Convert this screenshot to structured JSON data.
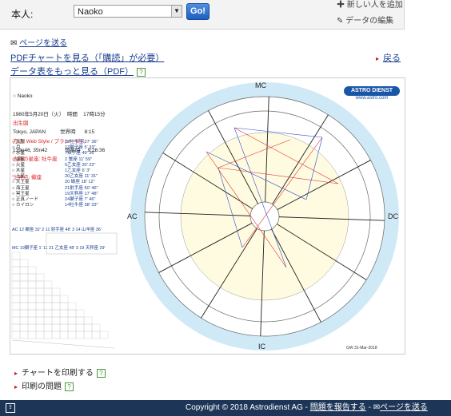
{
  "header": {
    "person_label": "本人:",
    "person_value": "Naoko",
    "go_label": "Go!",
    "add_label": "新しい人を追加",
    "edit_label": "データの編集"
  },
  "links": {
    "send_page": "ページを送る",
    "pdf_chart": "PDFチャートを見る（「購読」が必要）",
    "more_data": "データ表をもっと見る（PDF）",
    "back": "戻る",
    "help_glyph": "?"
  },
  "chart": {
    "name_line": "Naoko",
    "birth_line": "1980年5月20日（火）  時間    17時15分",
    "place_line": "Tokyo, JAPAN          世界時      8:15",
    "coord_line": "139e46, 35n42            恒星時     9:26:36",
    "method1": "出生図",
    "method2": "方法: Web Style / プラシーダス",
    "method3": "太陽の星座: 牡牛座",
    "method4": "上昇点: 蠍座",
    "logo_line1": "ASTRO DIENST",
    "logo_line2": "www.astro.com",
    "mc_label": "MC",
    "ic_label": "IC",
    "ac_label": "AC",
    "dc_label": "DC",
    "footer_code": "GW 31-Mar-2018",
    "planets": [
      {
        "name": "太陽",
        "pos": "29牡牛座 27' 36\""
      },
      {
        "name": "月",
        "pos": "13獅子座 5' 33\""
      },
      {
        "name": "水星",
        "pos": "7双子座 49' 36\""
      },
      {
        "name": "金星",
        "pos": "2 蟹座 11' 59\""
      },
      {
        "name": "火星",
        "pos": "5乙女座 20' 22\""
      },
      {
        "name": "木星",
        "pos": "1乙女座 6' 3\""
      },
      {
        "name": "土星",
        "pos": "20乙女座 11' 31\""
      },
      {
        "name": "天王星",
        "pos": "20 蠍座 18' 12\""
      },
      {
        "name": "海王星",
        "pos": "21射手座 50' 46\""
      },
      {
        "name": "冥王星",
        "pos": "19天秤座 17' 48\""
      },
      {
        "name": "正真ノード",
        "pos": "24獅子座 7' 46\""
      },
      {
        "name": "カイロン",
        "pos": "14牡牛座 38' 33\""
      }
    ],
    "houses1": "AC 12 蠍座 32' 2 11 射手座 48' 3 14 山羊座 36'",
    "houses2": "MC 19獅子座 1' 11 21 乙女座 48' 3 19 天秤座 29'"
  },
  "bottom": {
    "print_label": "チャートを印刷する",
    "print_problem_label": "印刷の問題"
  },
  "footer": {
    "copyright": "Copyright © 2018 Astrodienst AG",
    "report": "問題を報告する",
    "send": "ページを送る"
  }
}
